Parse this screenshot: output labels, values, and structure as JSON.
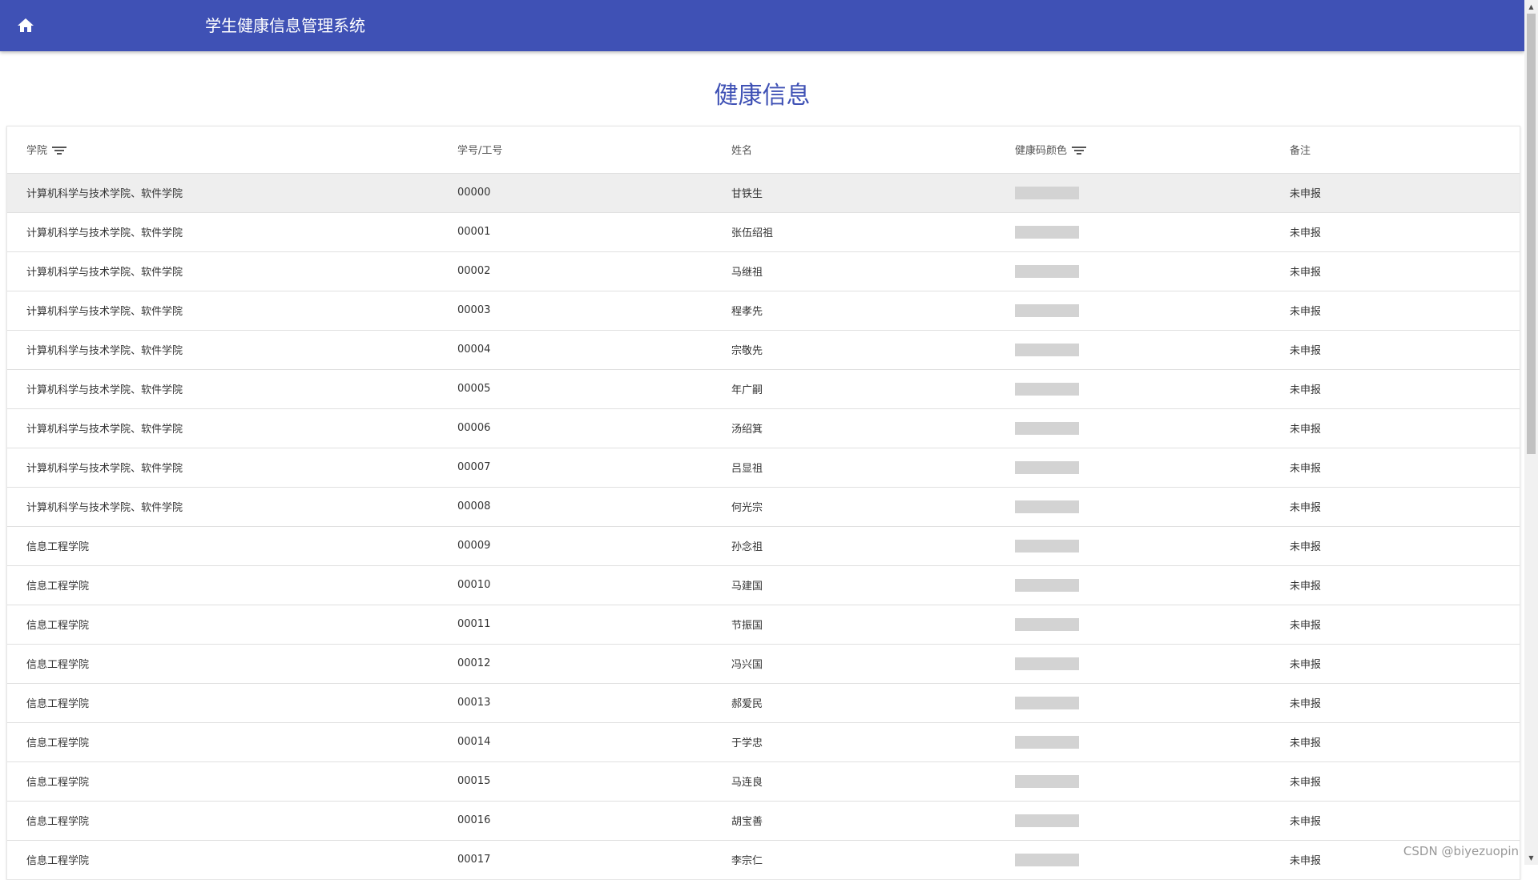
{
  "header": {
    "home_icon": "home-icon",
    "title": "学生健康信息管理系统"
  },
  "page_title": "健康信息",
  "table": {
    "columns": [
      "学院",
      "学号/工号",
      "姓名",
      "健康码颜色",
      "备注"
    ],
    "rows": [
      {
        "college": "计算机科学与技术学院、软件学院",
        "id": "00000",
        "name": "甘铁生",
        "note": "未申报"
      },
      {
        "college": "计算机科学与技术学院、软件学院",
        "id": "00001",
        "name": "张伍绍祖",
        "note": "未申报"
      },
      {
        "college": "计算机科学与技术学院、软件学院",
        "id": "00002",
        "name": "马继祖",
        "note": "未申报"
      },
      {
        "college": "计算机科学与技术学院、软件学院",
        "id": "00003",
        "name": "程孝先",
        "note": "未申报"
      },
      {
        "college": "计算机科学与技术学院、软件学院",
        "id": "00004",
        "name": "宗敬先",
        "note": "未申报"
      },
      {
        "college": "计算机科学与技术学院、软件学院",
        "id": "00005",
        "name": "年广嗣",
        "note": "未申报"
      },
      {
        "college": "计算机科学与技术学院、软件学院",
        "id": "00006",
        "name": "汤绍箕",
        "note": "未申报"
      },
      {
        "college": "计算机科学与技术学院、软件学院",
        "id": "00007",
        "name": "吕显祖",
        "note": "未申报"
      },
      {
        "college": "计算机科学与技术学院、软件学院",
        "id": "00008",
        "name": "何光宗",
        "note": "未申报"
      },
      {
        "college": "信息工程学院",
        "id": "00009",
        "name": "孙念祖",
        "note": "未申报"
      },
      {
        "college": "信息工程学院",
        "id": "00010",
        "name": "马建国",
        "note": "未申报"
      },
      {
        "college": "信息工程学院",
        "id": "00011",
        "name": "节振国",
        "note": "未申报"
      },
      {
        "college": "信息工程学院",
        "id": "00012",
        "name": "冯兴国",
        "note": "未申报"
      },
      {
        "college": "信息工程学院",
        "id": "00013",
        "name": "郝爱民",
        "note": "未申报"
      },
      {
        "college": "信息工程学院",
        "id": "00014",
        "name": "于学忠",
        "note": "未申报"
      },
      {
        "college": "信息工程学院",
        "id": "00015",
        "name": "马连良",
        "note": "未申报"
      },
      {
        "college": "信息工程学院",
        "id": "00016",
        "name": "胡宝善",
        "note": "未申报"
      },
      {
        "college": "信息工程学院",
        "id": "00017",
        "name": "李宗仁",
        "note": "未申报"
      }
    ],
    "highlighted_row": 0,
    "health_code_placeholder_color": "#d3d3d3"
  },
  "colors": {
    "appbar": "#3f51b5",
    "title": "#3f51b5"
  },
  "watermark": "CSDN @biyezuopin"
}
